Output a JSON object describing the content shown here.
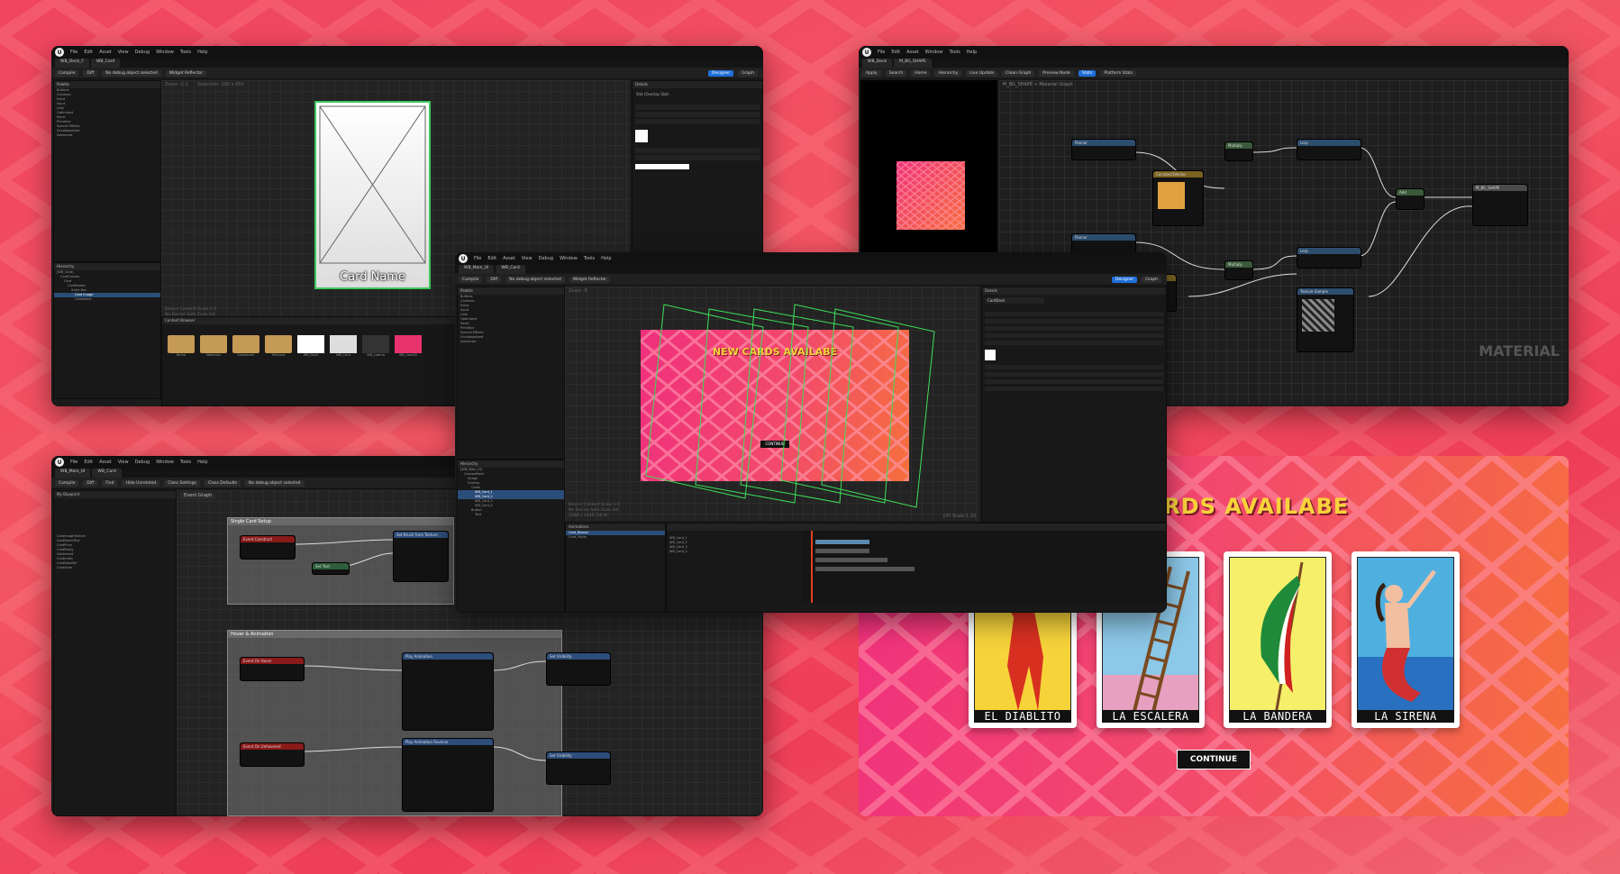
{
  "colors": {
    "brand_pink": "#f0445f",
    "accent_blue": "#1e6fd9",
    "card_title_yellow": "#f7d33a"
  },
  "window_tl": {
    "menu": [
      "File",
      "Edit",
      "Asset",
      "View",
      "Debug",
      "Window",
      "Tools",
      "Help"
    ],
    "tabs": [
      "WB_Deck_F",
      "WB_Card"
    ],
    "toolbar": [
      "Compile",
      "Diff",
      "No debug object selected",
      "Widget Reflector"
    ],
    "designer_btn": "Designer",
    "graph_btn": "Graph",
    "zoom": "Zoom -1:1",
    "selection": "Selection: 200 x 450",
    "card_name": "Card Name",
    "device_info": [
      "Device Content Scale 1.0",
      "No Device Safe Zone Set",
      "2560 x 1440 (16:9)"
    ],
    "details_title": "Details",
    "details_section": "Slot (Overlay Slot)",
    "palette": [
      "Buttons",
      "Common",
      "Extra",
      "Input",
      "Lists",
      "Optimized",
      "Panel",
      "Primitive",
      "Special Effects",
      "Uncategorized",
      "Advanced"
    ],
    "hierarchy_title": "Hierarchy",
    "hierarchy": [
      "[WB_Card]",
      "CardCanvas",
      "Card",
      "CardBorder",
      "Scale Box",
      "Card Image",
      "CardName"
    ],
    "content_title": "Content Browser",
    "assets": [
      "Bomb",
      "Materials",
      "Sandstorm",
      "Textures",
      "WB_Deck",
      "WB_Card",
      "WB_Loteria",
      "WB_Card02"
    ]
  },
  "window_tr": {
    "menu": [
      "File",
      "Edit",
      "Asset",
      "Window",
      "Tools",
      "Help"
    ],
    "tabs": [
      "WB_Deck",
      "M_BG_SHAPE"
    ],
    "toolbar": [
      "Apply",
      "Search",
      "Home",
      "Hierarchy",
      "Live Update",
      "Clean Graph",
      "Preview Node",
      "Stats",
      "Platform Stats"
    ],
    "graph_title": "M_BG_SHAPE > Material Graph",
    "material_watermark": "MATERIAL",
    "nodes": [
      "Panner",
      "Multiply",
      "Lerp",
      "Texture Sample",
      "Constant3Vector",
      "Add",
      "M_BG_SHAPE"
    ]
  },
  "window_bl": {
    "menu": [
      "File",
      "Edit",
      "Asset",
      "View",
      "Debug",
      "Window",
      "Tools",
      "Help"
    ],
    "tabs": [
      "WB_Main_UI",
      "WB_Card"
    ],
    "toolbar": [
      "Compile",
      "Diff",
      "Find",
      "Hide Unrelated",
      "Class Settings",
      "Class Defaults",
      "No debug object selected"
    ],
    "graph_tab": "Event Graph",
    "comment_1": "Single Card Setup",
    "comment_2": "Hover & Animation",
    "my_blueprint": "My Blueprint",
    "variables": [
      "CardImageTexture",
      "CardNameText",
      "CardPrice",
      "CardRarity",
      "IsSelected",
      "CardIndex",
      "CardDataRef",
      "CardAnim"
    ],
    "nodes": [
      "Event Construct",
      "Set Brush from Texture",
      "Set Text",
      "Event On Hover",
      "Play Animation",
      "Set Visibility",
      "Event On Unhovered",
      "Play Animation Reverse"
    ]
  },
  "window_center": {
    "menu": [
      "File",
      "Edit",
      "Asset",
      "View",
      "Debug",
      "Window",
      "Tools",
      "Help"
    ],
    "tabs": [
      "WB_Main_UI",
      "WB_Card"
    ],
    "toolbar": [
      "Compile",
      "Diff",
      "No debug object selected",
      "Widget Reflector"
    ],
    "designer_btn": "Designer",
    "graph_btn": "Graph",
    "zoom": "Zoom -5",
    "new_cards_title": "NEW CARDS AVAILABE",
    "mini_button": "CONTINUE",
    "device_info": [
      "Device Content Scale 1.0",
      "No Device Safe Zone Set",
      "2560 x 1440 (16:9)"
    ],
    "dpi": "DPI Scale 1.33",
    "details_title": "Details",
    "details_item": "CardDeck",
    "hierarchy_title": "Hierarchy",
    "hierarchy": [
      "[WB_Main_UI]",
      "CanvasPanel",
      "Image",
      "Overlay",
      "Cards",
      "WB_Card_1",
      "WB_Card_2",
      "WB_Card_3",
      "WB_Card_4",
      "Button",
      "Text"
    ],
    "anim_tab": "Animations",
    "anim_items": [
      "Card_Reveal",
      "Card_Hover"
    ],
    "timeline_tracks": [
      "WB_Card_1",
      "WB_Card_2",
      "WB_Card_3",
      "WB_Card_4"
    ]
  },
  "game_screen": {
    "title": "CARDS AVAILABE",
    "cards": [
      {
        "name": "EL DIABLITO",
        "color": "#f7d33a"
      },
      {
        "name": "LA ESCALERA",
        "color": "#8cc8e8"
      },
      {
        "name": "LA BANDERA",
        "color": "#f5ef6a"
      },
      {
        "name": "LA SIRENA",
        "color": "#4fb0e0"
      }
    ],
    "continue_label": "CONTINUE"
  }
}
